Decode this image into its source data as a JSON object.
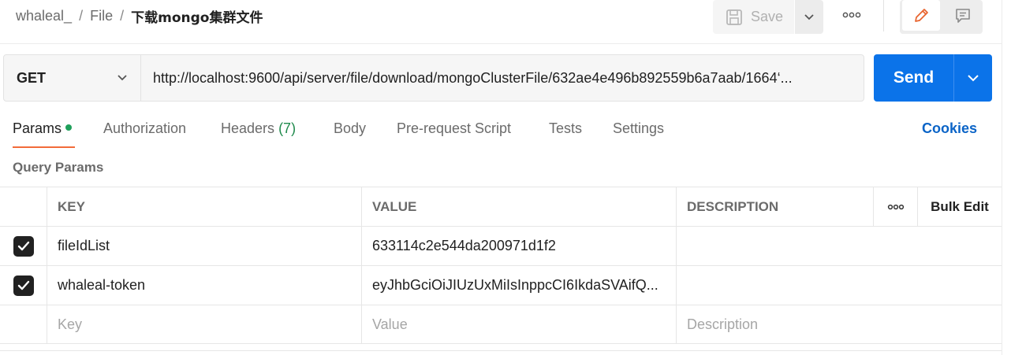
{
  "breadcrumb": {
    "items": [
      "whaleal_",
      "File"
    ],
    "separator": "/",
    "current": "下载mongo集群文件"
  },
  "toolbar": {
    "save_label": "Save",
    "save_icon": "floppy-disk-icon",
    "more_icon": "more-horizontal-icon",
    "edit_icon": "pencil-icon",
    "comment_icon": "comment-icon"
  },
  "request": {
    "method": "GET",
    "url": "http://localhost:9600/api/server/file/download/mongoClusterFile/632ae4e496b892559b6a7aab/1664‘...",
    "send_label": "Send"
  },
  "tabs": {
    "params": "Params",
    "authorization": "Authorization",
    "headers": "Headers",
    "headers_count": "(7)",
    "body": "Body",
    "pre_request": "Pre-request Script",
    "tests": "Tests",
    "settings": "Settings",
    "cookies": "Cookies"
  },
  "query_params": {
    "title": "Query Params",
    "columns": {
      "key": "KEY",
      "value": "VALUE",
      "description": "DESCRIPTION",
      "bulk_edit": "Bulk Edit"
    },
    "rows": [
      {
        "checked": true,
        "key": "fileIdList",
        "value": "633114c2e544da200971d1f2",
        "description": ""
      },
      {
        "checked": true,
        "key": "whaleal-token",
        "value": "eyJhbGciOiJIUzUxMiIsInppcCI6IkdaSVAifQ...",
        "description": ""
      }
    ],
    "placeholders": {
      "key": "Key",
      "value": "Value",
      "description": "Description"
    }
  },
  "colors": {
    "accent": "#0b73e9",
    "tab_indicator": "#f26b3a",
    "params_dot": "#1fa05b",
    "link": "#0b64c7",
    "edit_icon": "#e8622c"
  }
}
